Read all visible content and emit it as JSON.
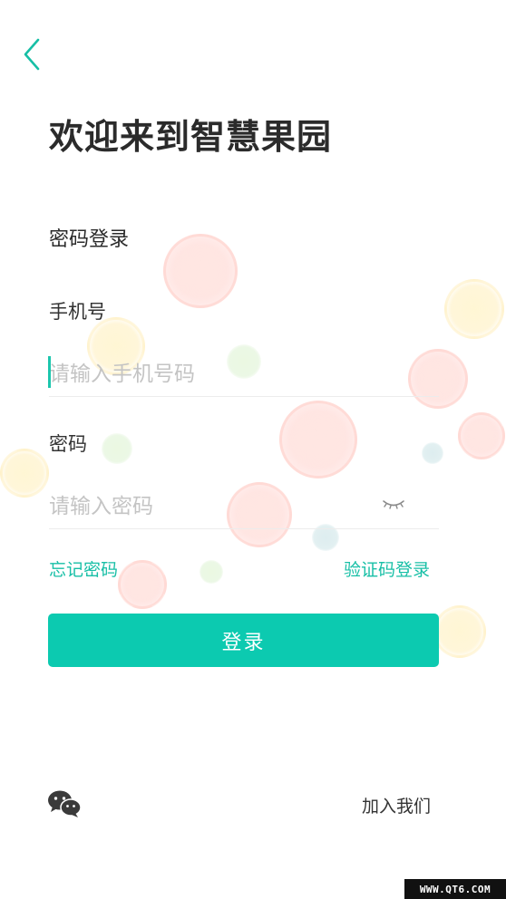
{
  "header": {
    "back_icon": "chevron-left-icon",
    "title": "欢迎来到智慧果园"
  },
  "login_form": {
    "mode_title": "密码登录",
    "phone": {
      "label": "手机号",
      "placeholder": "请输入手机号码",
      "value": ""
    },
    "password": {
      "label": "密码",
      "placeholder": "请输入密码",
      "value": "",
      "toggle_icon": "eye-closed-icon"
    },
    "forgot_password": "忘记密码",
    "sms_login": "验证码登录",
    "submit_label": "登录"
  },
  "footer": {
    "wechat_icon": "wechat-icon",
    "join_label": "加入我们"
  },
  "watermark": "WWW.QT6.COM",
  "colors": {
    "accent": "#0ccab0",
    "link": "#17bfa6",
    "title": "#2b2b2b",
    "placeholder": "#c4c4c4"
  }
}
